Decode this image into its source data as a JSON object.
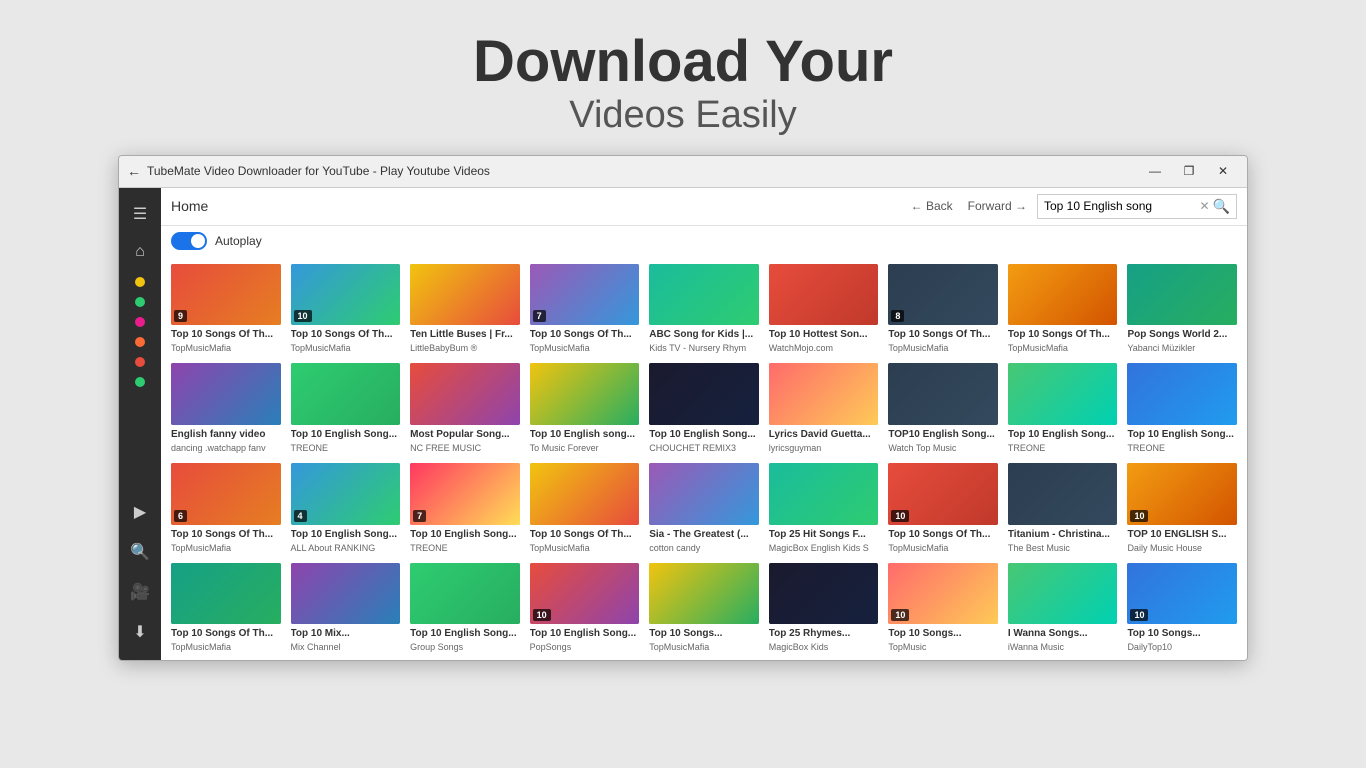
{
  "hero": {
    "title": "Download Your",
    "subtitle": "Videos Easily"
  },
  "window": {
    "title": "TubeMate Video Downloader for YouTube - Play Youtube Videos",
    "minimize": "—",
    "maximize": "❐",
    "close": "✕"
  },
  "toolbar": {
    "home": "Home",
    "back": "← Back",
    "forward": "Forward →",
    "search_value": "Top 10 English song"
  },
  "autoplay": {
    "label": "Autoplay"
  },
  "sidebar": {
    "dots": [
      "#f1c40f",
      "#2ecc71",
      "#e91e8c",
      "#ff6b35",
      "#e74c3c",
      "#2ecc71"
    ]
  },
  "videos": [
    {
      "title": "Top 10 Songs Of Th...",
      "channel": "TopMusicMafia",
      "badge": "9",
      "color": "t1"
    },
    {
      "title": "Top 10 Songs Of Th...",
      "channel": "TopMusicMafia",
      "badge": "10",
      "color": "t2"
    },
    {
      "title": "Ten Little Buses | Fr...",
      "channel": "LittleBabyBum ®",
      "badge": "",
      "color": "t3"
    },
    {
      "title": "Top 10 Songs Of Th...",
      "channel": "TopMusicMafia",
      "badge": "7",
      "color": "t4"
    },
    {
      "title": "ABC Song for Kids |...",
      "channel": "Kids TV - Nursery Rhym",
      "badge": "",
      "color": "t5"
    },
    {
      "title": "Top 10 Hottest Son...",
      "channel": "WatchMojo.com",
      "badge": "",
      "color": "t6"
    },
    {
      "title": "Top 10 Songs Of Th...",
      "channel": "TopMusicMafia",
      "badge": "8",
      "color": "t7"
    },
    {
      "title": "Top 10 Songs Of Th...",
      "channel": "TopMusicMafia",
      "badge": "",
      "color": "t8"
    },
    {
      "title": "Pop Songs World 2...",
      "channel": "Yabanci Müzikler",
      "badge": "",
      "color": "t9"
    },
    {
      "title": "English fanny video",
      "channel": "dancing .watchapp fanv",
      "badge": "",
      "color": "t10"
    },
    {
      "title": "Top 10 English Song...",
      "channel": "TREONE",
      "badge": "",
      "color": "t11"
    },
    {
      "title": "Most Popular Song...",
      "channel": "NC FREE MUSIC",
      "badge": "",
      "color": "t12"
    },
    {
      "title": "Top 10 English song...",
      "channel": "To Music Forever",
      "badge": "",
      "color": "t13"
    },
    {
      "title": "Top 10 English Song...",
      "channel": "CHOUCHET REMIX3",
      "badge": "",
      "color": "t14"
    },
    {
      "title": "Lyrics David Guetta...",
      "channel": "lyricsguyman",
      "badge": "",
      "color": "t15"
    },
    {
      "title": "TOP10 English Song...",
      "channel": "Watch Top Music",
      "badge": "",
      "color": "t7"
    },
    {
      "title": "Top 10 English Song...",
      "channel": "TREONE",
      "badge": "",
      "color": "t16"
    },
    {
      "title": "Top 10 English Song...",
      "channel": "TREONE",
      "badge": "",
      "color": "t17"
    },
    {
      "title": "Top 10 Songs Of Th...",
      "channel": "TopMusicMafia",
      "badge": "6",
      "color": "t1"
    },
    {
      "title": "Top 10 English Song...",
      "channel": "ALL About RANKING",
      "badge": "4",
      "color": "t2"
    },
    {
      "title": "Top 10 English Song...",
      "channel": "TREONE",
      "badge": "7",
      "color": "t18"
    },
    {
      "title": "Top 10 Songs Of Th...",
      "channel": "TopMusicMafia",
      "badge": "",
      "color": "t3"
    },
    {
      "title": "Sia - The Greatest (...",
      "channel": "cotton candy",
      "badge": "",
      "color": "t4"
    },
    {
      "title": "Top 25 Hit Songs F...",
      "channel": "MagicBox English Kids S",
      "badge": "",
      "color": "t5"
    },
    {
      "title": "Top 10 Songs Of Th...",
      "channel": "TopMusicMafia",
      "badge": "10",
      "color": "t6"
    },
    {
      "title": "Titanium - Christina...",
      "channel": "The Best Music",
      "badge": "",
      "color": "t7"
    },
    {
      "title": "TOP 10 ENGLISH S...",
      "channel": "Daily Music House",
      "badge": "10",
      "color": "t8"
    },
    {
      "title": "Top 10 Songs Of Th...",
      "channel": "TopMusicMafia",
      "badge": "",
      "color": "t9"
    },
    {
      "title": "Top 10 Mix...",
      "channel": "Mix Channel",
      "badge": "",
      "color": "t10"
    },
    {
      "title": "Top 10 English Song...",
      "channel": "Group Songs",
      "badge": "",
      "color": "t11"
    },
    {
      "title": "Top 10 English Song...",
      "channel": "PopSongs",
      "badge": "10",
      "color": "t12"
    },
    {
      "title": "Top 10 Songs...",
      "channel": "TopMusicMafia",
      "badge": "",
      "color": "t13"
    },
    {
      "title": "Top 25 Rhymes...",
      "channel": "MagicBox Kids",
      "badge": "",
      "color": "t14"
    },
    {
      "title": "Top 10 Songs...",
      "channel": "TopMusic",
      "badge": "10",
      "color": "t15"
    },
    {
      "title": "I Wanna Songs...",
      "channel": "iWanna Music",
      "badge": "",
      "color": "t16"
    },
    {
      "title": "Top 10 Songs...",
      "channel": "DailyTop10",
      "badge": "10",
      "color": "t17"
    }
  ]
}
